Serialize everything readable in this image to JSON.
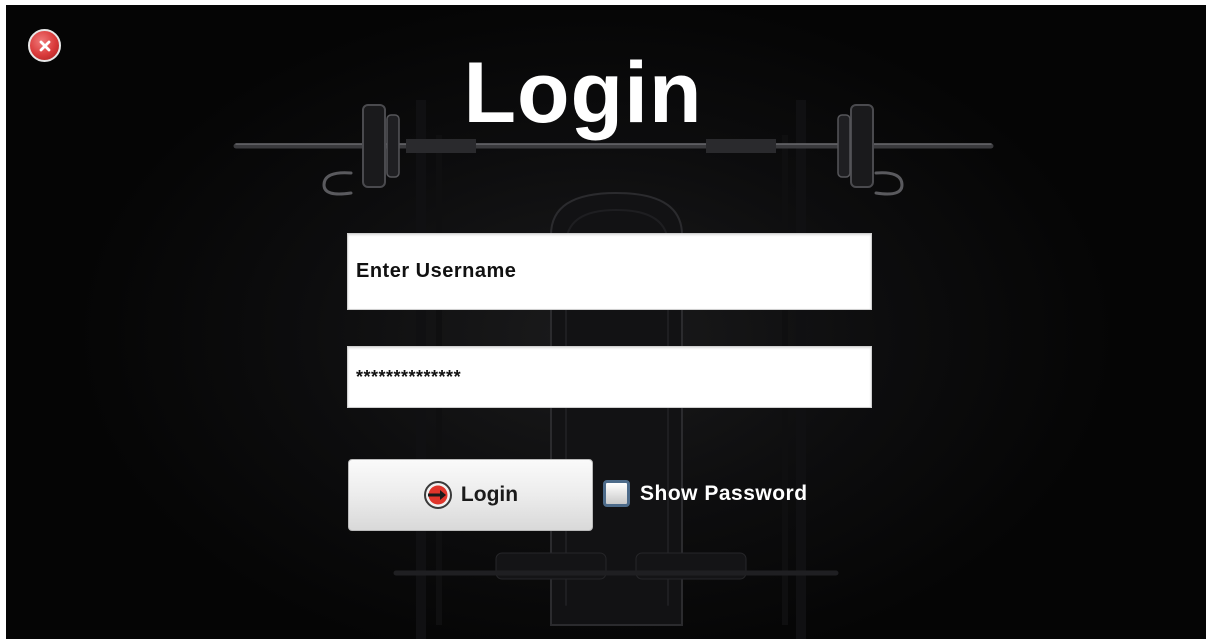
{
  "window": {
    "background_color": "#0b0b0c",
    "close_icon": "close-icon"
  },
  "title": "Login",
  "form": {
    "username_value": "Enter Username",
    "password_value": "**************",
    "login_button_label": "Login",
    "login_icon": "login-icon",
    "show_password_label": "Show Password",
    "show_password_checked": false
  }
}
